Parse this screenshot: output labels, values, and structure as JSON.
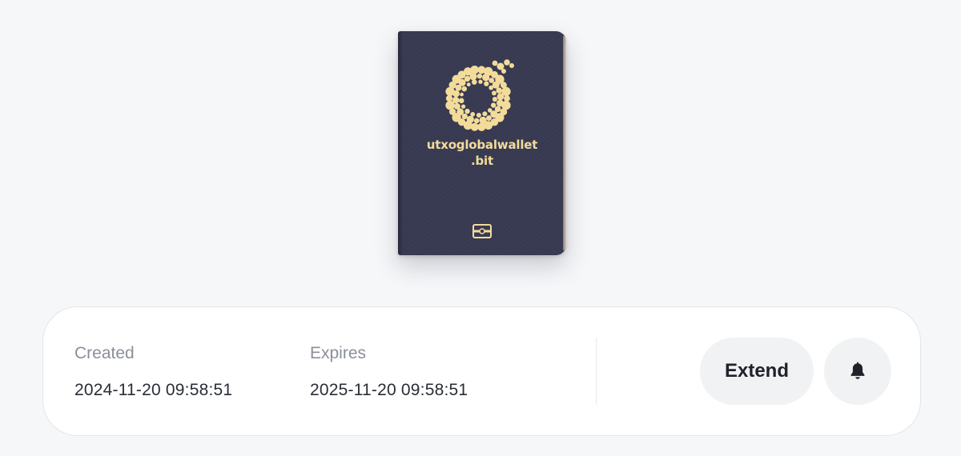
{
  "passport": {
    "name_line1": "utxoglobalwallet",
    "name_line2": ".bit",
    "logo_icon": "circular-dots-logo-icon",
    "chip_icon": "passport-chip-icon",
    "cover_color": "#383a52",
    "gold_color": "#f3dc9a"
  },
  "info": {
    "created_label": "Created",
    "created_value": "2024-11-20 09:58:51",
    "expires_label": "Expires",
    "expires_value": "2025-11-20 09:58:51"
  },
  "actions": {
    "extend_label": "Extend",
    "notify_icon": "bell-icon"
  }
}
